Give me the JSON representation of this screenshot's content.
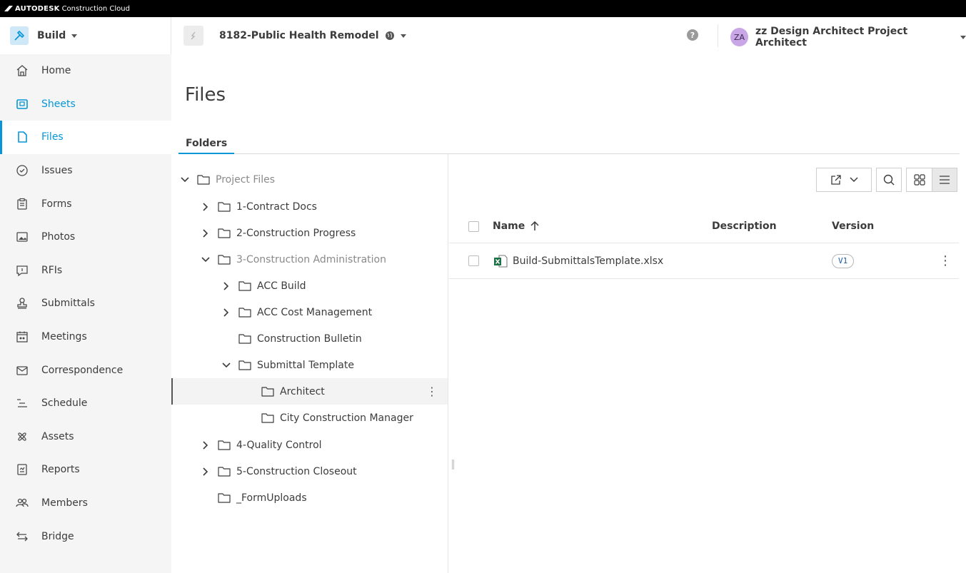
{
  "brand": {
    "name": "AUTODESK",
    "product": "Construction Cloud"
  },
  "header": {
    "module_label": "Build",
    "project_name": "8182-Public Health Remodel",
    "help_label": "?",
    "user_initials": "ZA",
    "user_name": "zz Design Architect Project Architect"
  },
  "sidebar": {
    "items": [
      {
        "label": "Home",
        "icon": "home-icon"
      },
      {
        "label": "Sheets",
        "icon": "sheets-icon"
      },
      {
        "label": "Files",
        "icon": "file-icon"
      },
      {
        "label": "Issues",
        "icon": "issues-icon"
      },
      {
        "label": "Forms",
        "icon": "forms-icon"
      },
      {
        "label": "Photos",
        "icon": "photos-icon"
      },
      {
        "label": "RFIs",
        "icon": "rfi-icon"
      },
      {
        "label": "Submittals",
        "icon": "submittals-icon"
      },
      {
        "label": "Meetings",
        "icon": "meetings-icon"
      },
      {
        "label": "Correspondence",
        "icon": "mail-icon"
      },
      {
        "label": "Schedule",
        "icon": "schedule-icon"
      },
      {
        "label": "Assets",
        "icon": "assets-icon"
      },
      {
        "label": "Reports",
        "icon": "reports-icon"
      },
      {
        "label": "Members",
        "icon": "members-icon"
      },
      {
        "label": "Bridge",
        "icon": "bridge-icon"
      }
    ]
  },
  "main": {
    "title": "Files",
    "tabs": [
      {
        "label": "Folders"
      }
    ]
  },
  "tree": {
    "items": [
      {
        "label": "Project Files"
      },
      {
        "label": "1-Contract Docs"
      },
      {
        "label": "2-Construction Progress"
      },
      {
        "label": "3-Construction Administration"
      },
      {
        "label": "ACC Build"
      },
      {
        "label": "ACC Cost Management"
      },
      {
        "label": "Construction Bulletin"
      },
      {
        "label": "Submittal Template"
      },
      {
        "label": "Architect"
      },
      {
        "label": "City Construction Manager"
      },
      {
        "label": "4-Quality Control"
      },
      {
        "label": "5-Construction Closeout"
      },
      {
        "label": "_FormUploads"
      }
    ]
  },
  "table": {
    "columns": {
      "name": "Name",
      "description": "Description",
      "version": "Version"
    },
    "rows": [
      {
        "name": "Build-SubmittalsTemplate.xlsx",
        "description": "",
        "version": "V1"
      }
    ]
  },
  "colors": {
    "accent": "#0696d7",
    "sidebar_bg": "#f5f5f5",
    "avatar": "#c9a6e5",
    "excel_green": "#1e7145"
  }
}
